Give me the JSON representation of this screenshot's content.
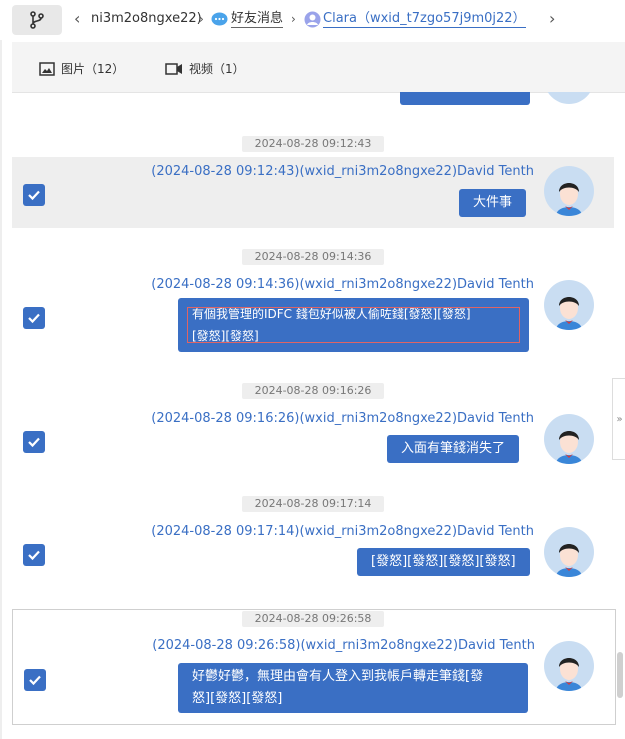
{
  "breadcrumb": {
    "crumb1": "ni3m2o8ngxe22)",
    "crumb2": "好友消息",
    "crumb3": "Clara（wxid_t7zgo57j9m0j22）"
  },
  "tabs": [
    {
      "label": "图片（12）"
    },
    {
      "label": "视频（1）"
    }
  ],
  "messages": [
    {
      "time": "2024-08-28 09:12:43",
      "header": "(2024-08-28 09:12:43)(wxid_rni3m2o8ngxe22)David Tenth",
      "line1": "大件事",
      "line2": ""
    },
    {
      "time": "2024-08-28 09:14:36",
      "header": "(2024-08-28 09:14:36)(wxid_rni3m2o8ngxe22)David Tenth",
      "line1": "有個我管理的IDFC 錢包好似被人偷咗錢[發怒][發怒]",
      "line2": "[發怒][發怒]"
    },
    {
      "time": "2024-08-28 09:16:26",
      "header": "(2024-08-28 09:16:26)(wxid_rni3m2o8ngxe22)David Tenth",
      "line1": "入面有筆錢消失了",
      "line2": ""
    },
    {
      "time": "2024-08-28 09:17:14",
      "header": "(2024-08-28 09:17:14)(wxid_rni3m2o8ngxe22)David Tenth",
      "line1": "[發怒][發怒][發怒][發怒]",
      "line2": ""
    },
    {
      "time": "2024-08-28 09:26:58",
      "header": "(2024-08-28 09:26:58)(wxid_rni3m2o8ngxe22)David Tenth",
      "line1": "好鬱好鬱，無理由會有人登入到我帳戶轉走筆錢[發",
      "line2": "怒][發怒][發怒]"
    }
  ],
  "expand_label": "»",
  "colors": {
    "accent": "#3a6fc4",
    "highlight_border": "#e06464"
  }
}
